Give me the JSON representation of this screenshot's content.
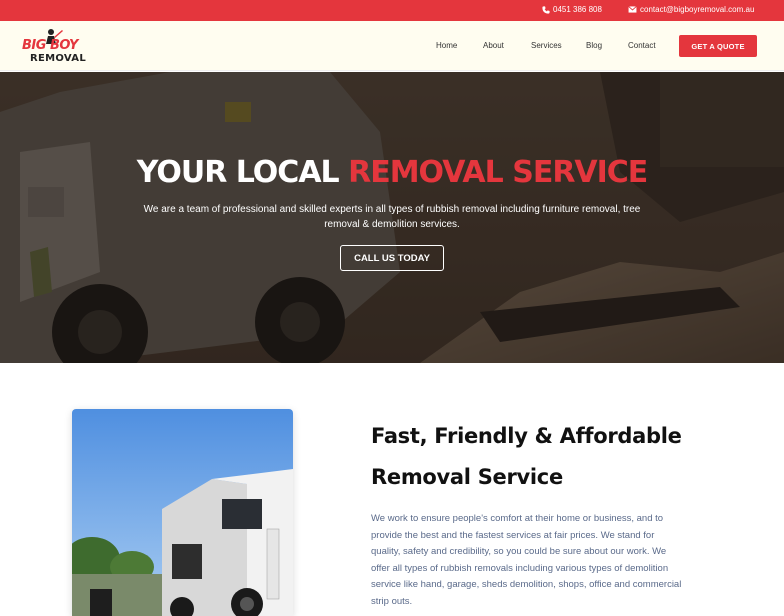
{
  "topbar": {
    "phone": "0451 386 808",
    "email": "contact@bigboyremoval.com.au"
  },
  "logo": {
    "line1": "BIG BOY",
    "line2": "REMOVAL"
  },
  "nav": {
    "items": [
      "Home",
      "About",
      "Services",
      "Blog",
      "Contact"
    ],
    "cta": "GET A QUOTE"
  },
  "hero": {
    "title_white": "YOUR LOCAL ",
    "title_red": "REMOVAL SERVICE",
    "subtitle": "We are a team of professional and skilled experts in all types of rubbish removal including furniture removal, tree removal & demolition services.",
    "button": "CALL US TODAY"
  },
  "about": {
    "heading_line1": "Fast, Friendly & Affordable",
    "heading_line2": "Removal Service",
    "body": "We work to ensure people's comfort at their home or business, and to provide the best and the fastest services at fair prices. We stand for quality, safety and credibility, so you could be sure about our work. We offer all types of rubbish removals including various types of demolition service like hand, garage, sheds demolition, shops, office and commercial strip outs."
  },
  "colors": {
    "accent": "#e4363d",
    "header_bg": "#fffdf0",
    "body_text": "#5a6a8a"
  }
}
